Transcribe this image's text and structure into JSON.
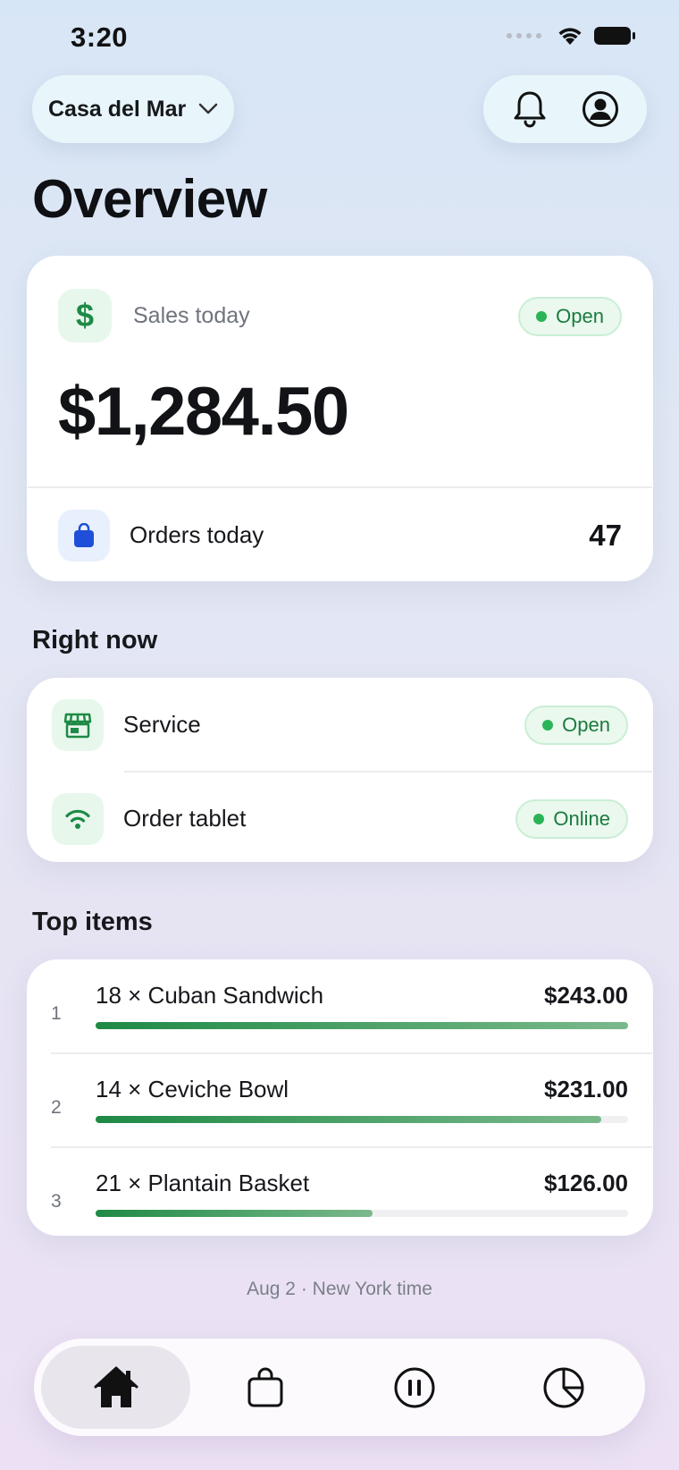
{
  "status_bar": {
    "time": "3:20"
  },
  "header": {
    "restaurant_name": "Casa del Mar"
  },
  "page": {
    "title": "Overview"
  },
  "sales": {
    "label": "Sales today",
    "status": "Open",
    "amount": "$1,284.50",
    "orders_label": "Orders today",
    "orders_count": "47"
  },
  "right_now": {
    "title": "Right now",
    "items": [
      {
        "label": "Service",
        "status": "Open",
        "icon": "storefront-icon"
      },
      {
        "label": "Order tablet",
        "status": "Online",
        "icon": "wifi-icon"
      }
    ]
  },
  "top_items": {
    "title": "Top items",
    "items": [
      {
        "rank": "1",
        "name": "18 × Cuban Sandwich",
        "price": "$243.00",
        "share": 1.0
      },
      {
        "rank": "2",
        "name": "14 × Ceviche Bowl",
        "price": "$231.00",
        "share": 0.95
      },
      {
        "rank": "3",
        "name": "21 × Plantain Basket",
        "price": "$126.00",
        "share": 0.52
      }
    ]
  },
  "footer": {
    "note": "Aug 2 · New York time"
  },
  "tab_bar": {
    "tabs": [
      {
        "icon": "home-icon",
        "active": true
      },
      {
        "icon": "bag-icon",
        "active": false
      },
      {
        "icon": "pause-icon",
        "active": false
      },
      {
        "icon": "pie-chart-icon",
        "active": false
      }
    ]
  },
  "colors": {
    "accent_green": "#1e8a45",
    "status_dot": "#2bb457",
    "bag_blue": "#1f4fd8"
  }
}
